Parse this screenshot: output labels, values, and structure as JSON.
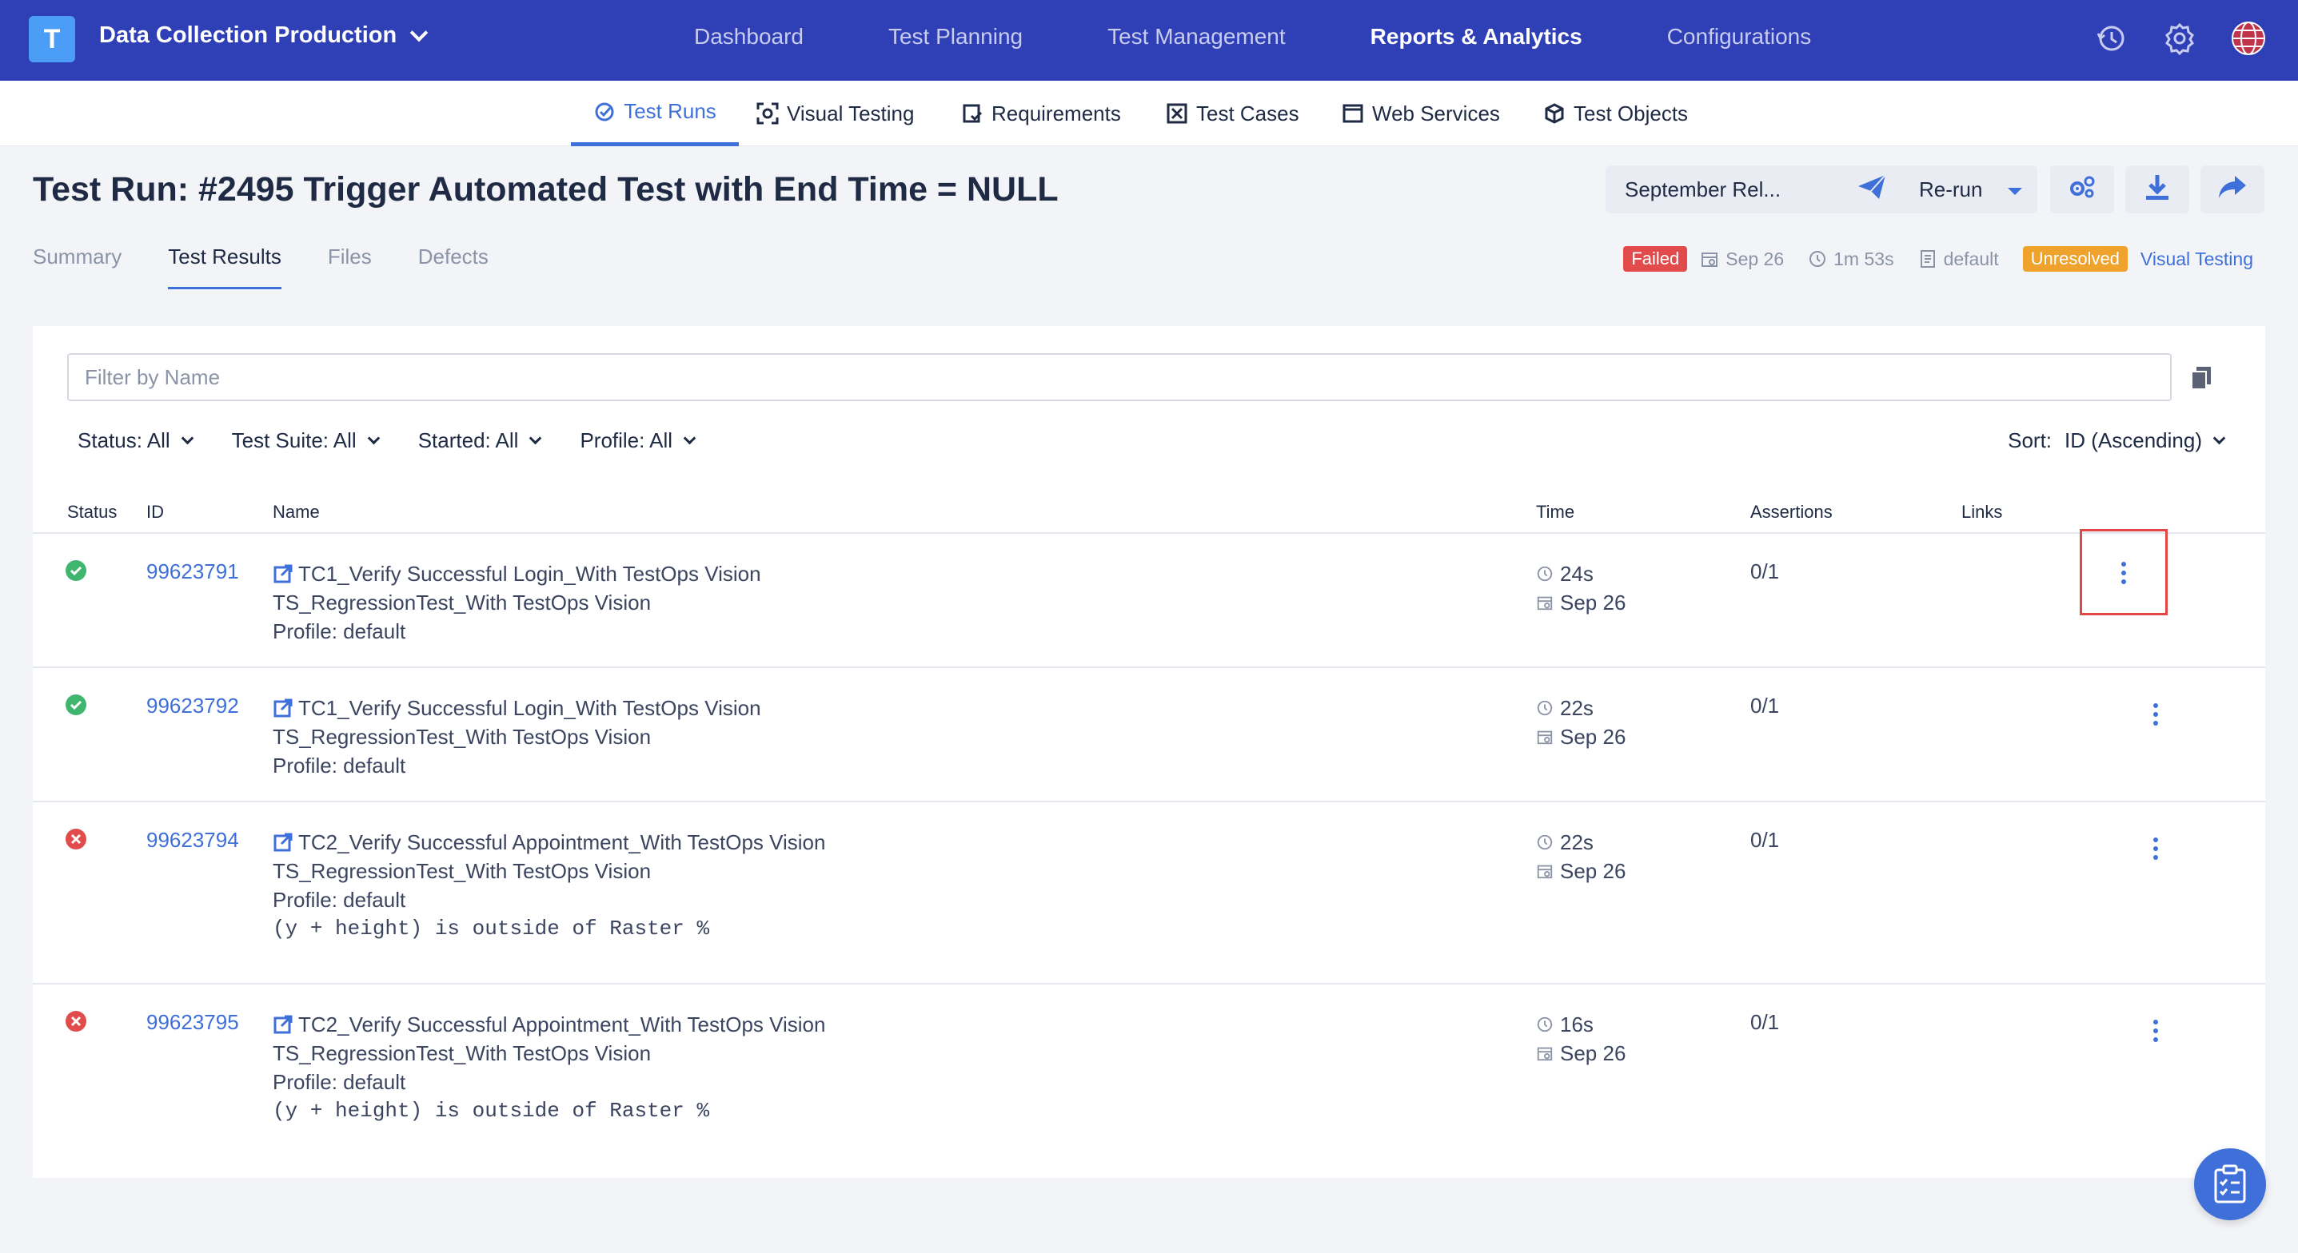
{
  "topnav": {
    "logo_letter": "T",
    "project_name": "Data Collection Production",
    "links": [
      {
        "label": "Dashboard",
        "active": false
      },
      {
        "label": "Test Planning",
        "active": false
      },
      {
        "label": "Test Management",
        "active": false
      },
      {
        "label": "Reports & Analytics",
        "active": true
      },
      {
        "label": "Configurations",
        "active": false
      }
    ],
    "icons": [
      "history-icon",
      "gear-icon",
      "globe-icon"
    ]
  },
  "subnav": {
    "items": [
      {
        "label": "Test Runs",
        "icon": "check-circle-icon",
        "active": true
      },
      {
        "label": "Visual Testing",
        "icon": "focus-icon",
        "active": false
      },
      {
        "label": "Requirements",
        "icon": "requirements-icon",
        "active": false
      },
      {
        "label": "Test Cases",
        "icon": "test-case-icon",
        "active": false
      },
      {
        "label": "Web Services",
        "icon": "window-icon",
        "active": false
      },
      {
        "label": "Test Objects",
        "icon": "cube-icon",
        "active": false
      }
    ]
  },
  "header": {
    "title": "Test Run: #2495 Trigger Automated Test with End Time = NULL",
    "release_button": "September Rel...",
    "rerun_button": "Re-run"
  },
  "tabs": [
    {
      "label": "Summary",
      "active": false
    },
    {
      "label": "Test Results",
      "active": true
    },
    {
      "label": "Files",
      "active": false
    },
    {
      "label": "Defects",
      "active": false
    }
  ],
  "meta": {
    "status": "Failed",
    "date": "Sep 26",
    "duration": "1m 53s",
    "profile": "default",
    "visual_status": "Unresolved",
    "visual_link": "Visual Testing"
  },
  "filters": {
    "search_placeholder": "Filter by Name",
    "status": "Status: All",
    "suite": "Test Suite: All",
    "started": "Started: All",
    "profile": "Profile: All",
    "sort_label": "Sort:",
    "sort_value": "ID (Ascending)"
  },
  "table": {
    "headers": {
      "status": "Status",
      "id": "ID",
      "name": "Name",
      "time": "Time",
      "assertions": "Assertions",
      "links": "Links"
    },
    "rows": [
      {
        "status": "passed",
        "id": "99623791",
        "name": "TC1_Verify Successful Login_With TestOps Vision",
        "suite": "TS_RegressionTest_With TestOps Vision",
        "profile": "Profile: default",
        "error": "",
        "duration": "24s",
        "date": "Sep 26",
        "assertions": "0/1"
      },
      {
        "status": "passed",
        "id": "99623792",
        "name": "TC1_Verify Successful Login_With TestOps Vision",
        "suite": "TS_RegressionTest_With TestOps Vision",
        "profile": "Profile: default",
        "error": "",
        "duration": "22s",
        "date": "Sep 26",
        "assertions": "0/1"
      },
      {
        "status": "failed",
        "id": "99623794",
        "name": "TC2_Verify Successful Appointment_With TestOps Vision",
        "suite": "TS_RegressionTest_With TestOps Vision",
        "profile": "Profile: default",
        "error": "(y + height) is outside of Raster %",
        "duration": "22s",
        "date": "Sep 26",
        "assertions": "0/1"
      },
      {
        "status": "failed",
        "id": "99623795",
        "name": "TC2_Verify Successful Appointment_With TestOps Vision",
        "suite": "TS_RegressionTest_With TestOps Vision",
        "profile": "Profile: default",
        "error": "(y + height) is outside of Raster %",
        "duration": "16s",
        "date": "Sep 26",
        "assertions": "0/1"
      }
    ]
  },
  "colors": {
    "nav_bg": "#2f3fb6",
    "accent": "#3f6fd8",
    "passed": "#3fb56f",
    "failed": "#e14b4b",
    "unresolved": "#efa22c",
    "highlight_border": "#e04848"
  }
}
